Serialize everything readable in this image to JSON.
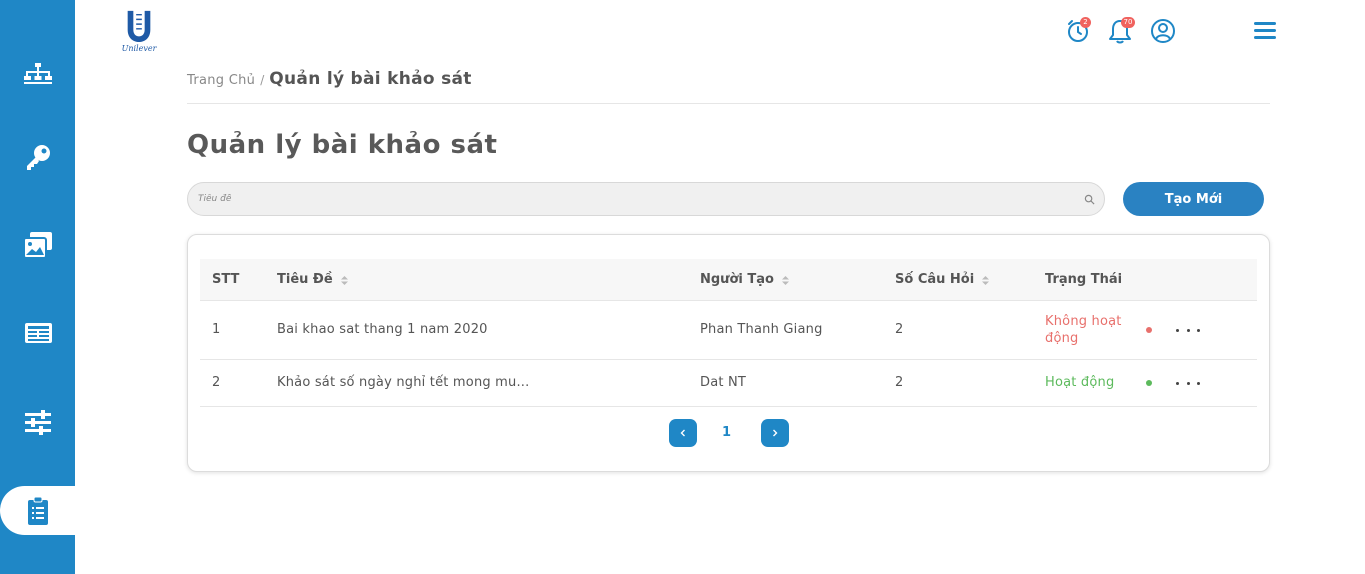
{
  "brand": {
    "logo_text": "Unilever",
    "accent": "#1f87c6"
  },
  "sidebar": {
    "items": [
      {
        "icon": "sitemap-icon"
      },
      {
        "icon": "key-icon"
      },
      {
        "icon": "images-icon"
      },
      {
        "icon": "news-icon"
      },
      {
        "icon": "sliders-icon"
      },
      {
        "icon": "clipboard-list-icon",
        "active": true
      }
    ]
  },
  "header": {
    "alarm_badge": "2",
    "notification_badge": "70"
  },
  "breadcrumb": {
    "home": "Trang Chủ",
    "separator": "/",
    "current": "Quản lý bài khảo sát"
  },
  "page": {
    "title": "Quản lý bài khảo sát",
    "search_placeholder": "Tiêu đề",
    "create_button": "Tạo Mới"
  },
  "table": {
    "columns": [
      "STT",
      "Tiêu Đề",
      "Người Tạo",
      "Số Câu Hỏi",
      "Trạng Thái"
    ],
    "rows": [
      {
        "stt": "1",
        "title": "Bai khao sat thang 1 nam 2020",
        "creator": "Phan Thanh Giang",
        "questions": "2",
        "status": "Không hoạt động",
        "status_color": "#e8706c"
      },
      {
        "stt": "2",
        "title": "Khảo sát số ngày nghỉ tết mong mu...",
        "creator": "Dat NT",
        "questions": "2",
        "status": "Hoạt động",
        "status_color": "#5cba5c"
      }
    ]
  },
  "pagination": {
    "current_page": "1"
  }
}
